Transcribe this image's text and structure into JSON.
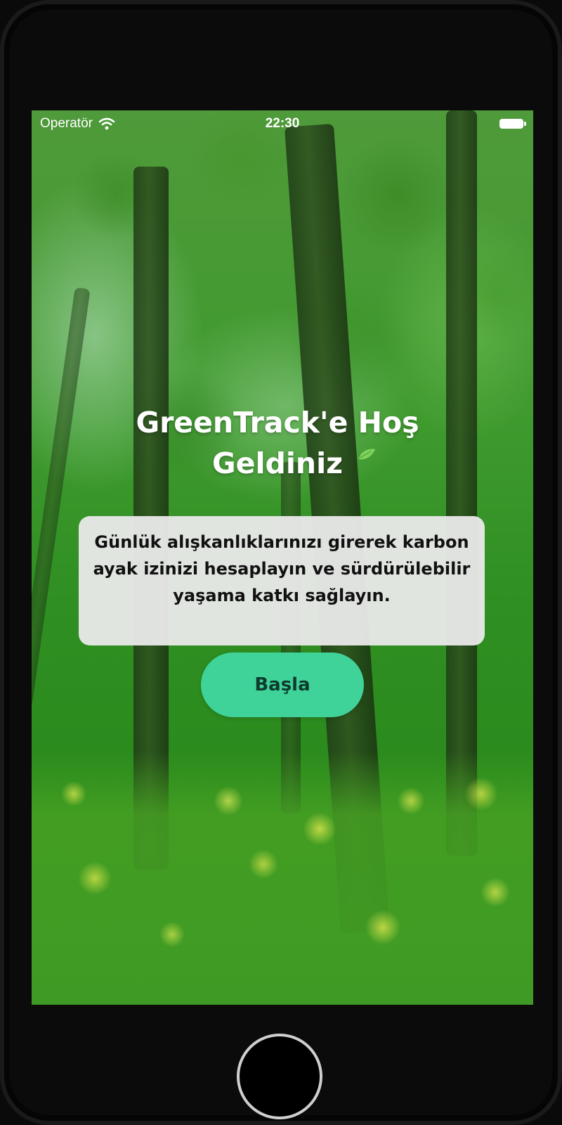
{
  "status_bar": {
    "carrier": "Operatör",
    "wifi_icon": "wifi-icon",
    "time": "22:30",
    "battery_icon": "battery-icon"
  },
  "welcome": {
    "title_line1": "GreenTrack'e Hoş",
    "title_line2": "Geldiniz"
  },
  "description": {
    "text": "Günlük alışkanlıklarınızı girerek karbon ayak izinizi hesaplayın ve sürdürülebilir yaşama katkı sağlayın."
  },
  "actions": {
    "start_label": "Başla"
  },
  "colors": {
    "start_button": "#3fd39a",
    "card_background": "#e8e8e8"
  }
}
